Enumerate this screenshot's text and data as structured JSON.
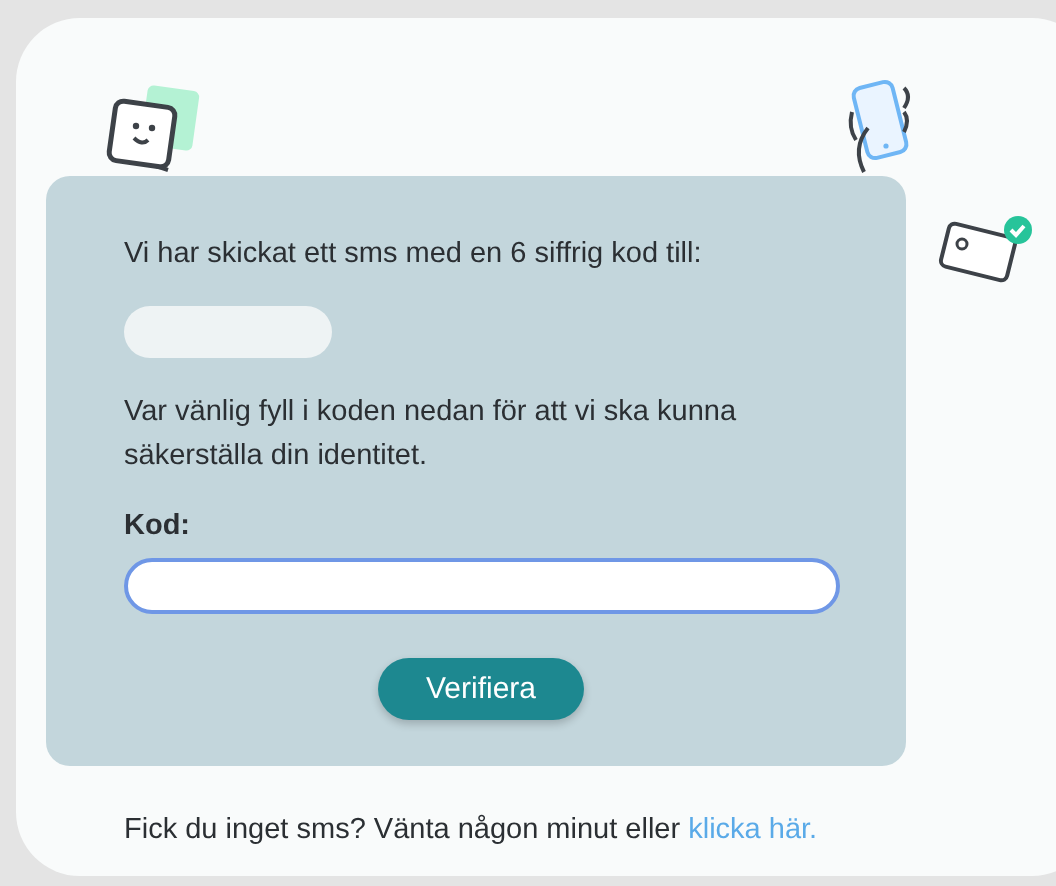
{
  "panel": {
    "intro": "Vi har skickat ett sms med en 6 siffrig kod till:",
    "masked_number": {
      "kind": "masked"
    },
    "instruction": "Var vänlig fyll i koden nedan för att vi ska kunna säkerställa din identitet.",
    "code_label": "Kod:",
    "code_field": {
      "focused": true
    },
    "button": "Verifiera"
  },
  "footer": {
    "text": "Fick du inget sms? Vänta någon minut eller ",
    "link": "klicka här."
  }
}
